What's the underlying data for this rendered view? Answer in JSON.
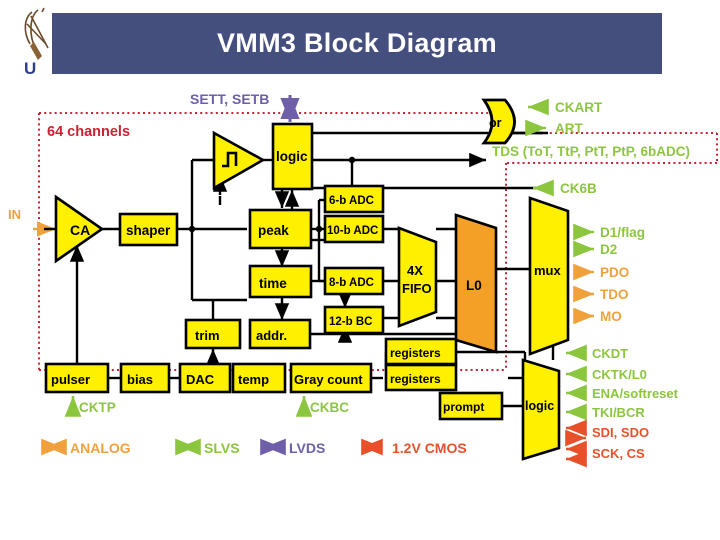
{
  "slide": {
    "title": "VMM3 Block Diagram",
    "title_bg": "#454f7e",
    "logo_letter": "U"
  },
  "diagram": {
    "boundary_label": "64 channels",
    "boundary_color": "#cc2233",
    "block_fill": "#fff000",
    "block_fill_orange": "#f4a026",
    "colors": {
      "analog": "#f0a13c",
      "slvs": "#8cc63f",
      "lvds": "#6f5fa8",
      "cmos": "#e8502a",
      "red_dashed": "#cc2233"
    },
    "blocks": [
      {
        "id": "ca",
        "label": "CA",
        "shape": "triangle"
      },
      {
        "id": "shaper",
        "label": "shaper",
        "shape": "rect"
      },
      {
        "id": "schmitt",
        "label": "",
        "shape": "triangle-schmitt"
      },
      {
        "id": "logic_top",
        "label": "logic",
        "shape": "rect"
      },
      {
        "id": "peak",
        "label": "peak",
        "shape": "rect"
      },
      {
        "id": "time",
        "label": "time",
        "shape": "rect"
      },
      {
        "id": "adc6",
        "label": "6-b ADC",
        "shape": "rect"
      },
      {
        "id": "adc10",
        "label": "10-b ADC",
        "shape": "rect"
      },
      {
        "id": "adc8",
        "label": "8-b ADC",
        "shape": "rect"
      },
      {
        "id": "bc12",
        "label": "12-b BC",
        "shape": "rect"
      },
      {
        "id": "fifo",
        "label": "4X FIFO",
        "shape": "trapezoid"
      },
      {
        "id": "l0",
        "label": "L0",
        "shape": "parallelogram"
      },
      {
        "id": "mux",
        "label": "mux",
        "shape": "trapezoid"
      },
      {
        "id": "trim",
        "label": "trim",
        "shape": "rect"
      },
      {
        "id": "addr",
        "label": "addr.",
        "shape": "rect"
      },
      {
        "id": "pulser",
        "label": "pulser",
        "shape": "rect"
      },
      {
        "id": "bias",
        "label": "bias",
        "shape": "rect"
      },
      {
        "id": "dac",
        "label": "DAC",
        "shape": "rect"
      },
      {
        "id": "temp",
        "label": "temp",
        "shape": "rect"
      },
      {
        "id": "graycount",
        "label": "Gray count",
        "shape": "rect"
      },
      {
        "id": "registers1",
        "label": "registers",
        "shape": "rect"
      },
      {
        "id": "registers2",
        "label": "registers",
        "shape": "rect"
      },
      {
        "id": "prompt",
        "label": "prompt",
        "shape": "rect"
      },
      {
        "id": "logic_bot",
        "label": "logic",
        "shape": "trapezoid"
      },
      {
        "id": "orgate",
        "label": "or",
        "shape": "or-gate"
      }
    ],
    "block_labels": {
      "ca": "CA",
      "shaper": "shaper",
      "logic_top": "logic",
      "peak": "peak",
      "time": "time",
      "adc6": "6-b ADC",
      "adc10": "10-b ADC",
      "adc8": "8-b ADC",
      "bc12": "12-b BC",
      "fifo_line1": "4X",
      "fifo_line2": "FIFO",
      "l0": "L0",
      "mux": "mux",
      "trim": "trim",
      "addr": "addr.",
      "pulser": "pulser",
      "bias": "bias",
      "dac": "DAC",
      "temp": "temp",
      "graycount": "Gray count",
      "registers1": "registers",
      "registers2": "registers",
      "prompt": "prompt",
      "logic_bot": "logic",
      "orgate": "or"
    },
    "signals": {
      "in": "IN",
      "sett_setb": "SETT, SETB",
      "ckart": "CKART",
      "art": "ART",
      "tds": "TDS (ToT, TtP, PtT, PtP, 6bADC)",
      "ck6b": "CK6B",
      "d1flag": "D1/flag",
      "d2": "D2",
      "pdo": "PDO",
      "tdo": "TDO",
      "mo": "MO",
      "ckdt": "CKDT",
      "cktk_l0": "CKTK/L0",
      "ena_softreset": "ENA/softreset",
      "tki_bcr": "TKI/BCR",
      "sdi_sdo": "SDI, SDO",
      "sck_cs": "SCK, CS",
      "cktp": "CKTP",
      "ckbc": "CKBC"
    },
    "legend": [
      {
        "label": "ANALOG",
        "color": "#f0a13c",
        "arrow": "double"
      },
      {
        "label": "SLVS",
        "color": "#8cc63f",
        "arrow": "double"
      },
      {
        "label": "LVDS",
        "color": "#6f5fa8",
        "arrow": "double"
      },
      {
        "label": "1.2V CMOS",
        "color": "#e8502a",
        "arrow": "double"
      }
    ]
  }
}
